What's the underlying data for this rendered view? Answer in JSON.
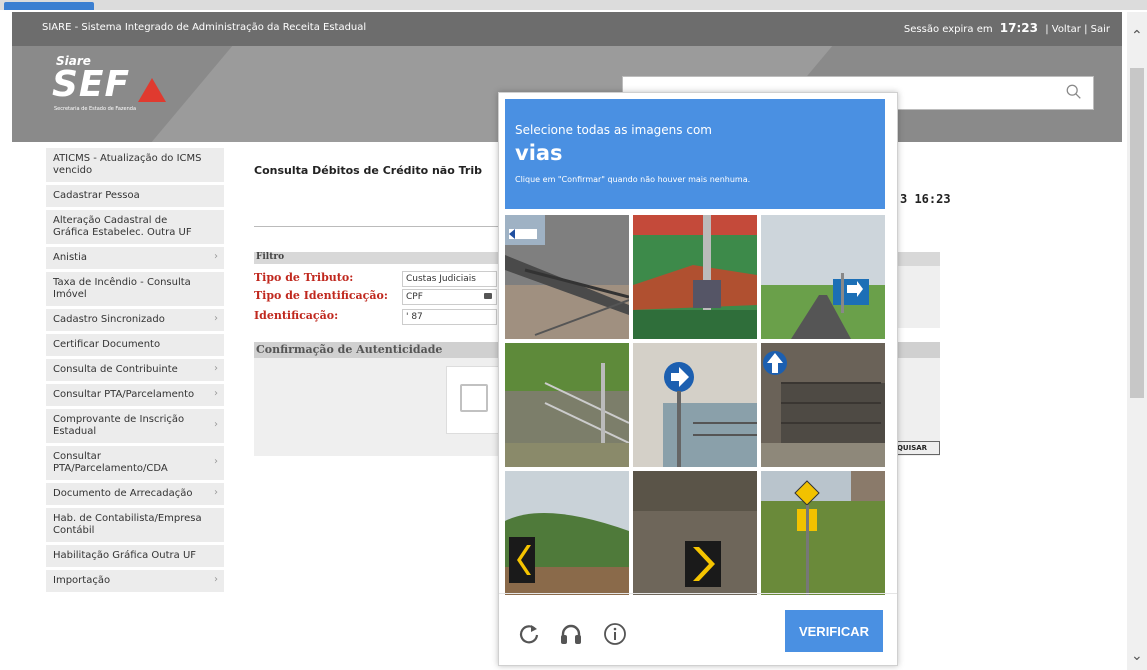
{
  "header": {
    "system_name": "SIARE - Sistema Integrado de Administração da Receita Estadual",
    "session_label": "Sessão expira em",
    "session_time": "17:23",
    "back_link": "Voltar",
    "sep": "|",
    "exit_link": "Sair",
    "logo_top": "Siare",
    "logo_main": "SEF",
    "logo_sub": "Secretaria de Estado de Fazenda"
  },
  "sidebar": {
    "items": [
      {
        "label": "ATICMS - Atualização do ICMS vencido",
        "chevron": ""
      },
      {
        "label": "Cadastrar Pessoa",
        "chevron": ""
      },
      {
        "label": "Alteração Cadastral de Gráfica Estabelec. Outra UF",
        "chevron": ""
      },
      {
        "label": "Anistia",
        "chevron": "›"
      },
      {
        "label": "Taxa de Incêndio - Consulta Imóvel",
        "chevron": ""
      },
      {
        "label": "Cadastro Sincronizado",
        "chevron": "›"
      },
      {
        "label": "Certificar Documento",
        "chevron": ""
      },
      {
        "label": "Consulta de Contribuinte",
        "chevron": "›"
      },
      {
        "label": "Consultar PTA/Parcelamento",
        "chevron": "›"
      },
      {
        "label": "Comprovante de Inscrição Estadual",
        "chevron": "›"
      },
      {
        "label": "Consultar PTA/Parcelamento/CDA",
        "chevron": "›"
      },
      {
        "label": "Documento de Arrecadação",
        "chevron": "›"
      },
      {
        "label": "Hab. de Contabilista/Empresa Contábil",
        "chevron": ""
      },
      {
        "label": "Habilitação Gráfica Outra UF",
        "chevron": ""
      },
      {
        "label": "Importação",
        "chevron": "›"
      }
    ]
  },
  "main": {
    "title": "Consulta Débitos de Crédito não Trib",
    "datetime": "3 16:23",
    "filter_title": "Filtro",
    "tipo_tributo_label": "Tipo de Tributo:",
    "tipo_tributo_value": "Custas Judiciais",
    "tipo_ident_label": "Tipo de Identificação:",
    "tipo_ident_value": "CPF",
    "ident_label": "Identificação:",
    "ident_value": "'   87",
    "auth_title": "Confirmação de Autenticidade",
    "search_button": "QUISAR"
  },
  "captcha": {
    "line1": "Selecione todas as imagens com",
    "keyword": "vias",
    "line3": "Clique em \"Confirmar\" quando não houver mais nenhuma.",
    "verify_label": "VERIFICAR",
    "refresh_icon": "refresh-icon",
    "audio_icon": "headphones-icon",
    "info_icon": "info-icon"
  },
  "colors": {
    "captcha_blue": "#4a90e2",
    "label_red": "#c0281e",
    "titlebar_gray": "#6d6d6d"
  }
}
